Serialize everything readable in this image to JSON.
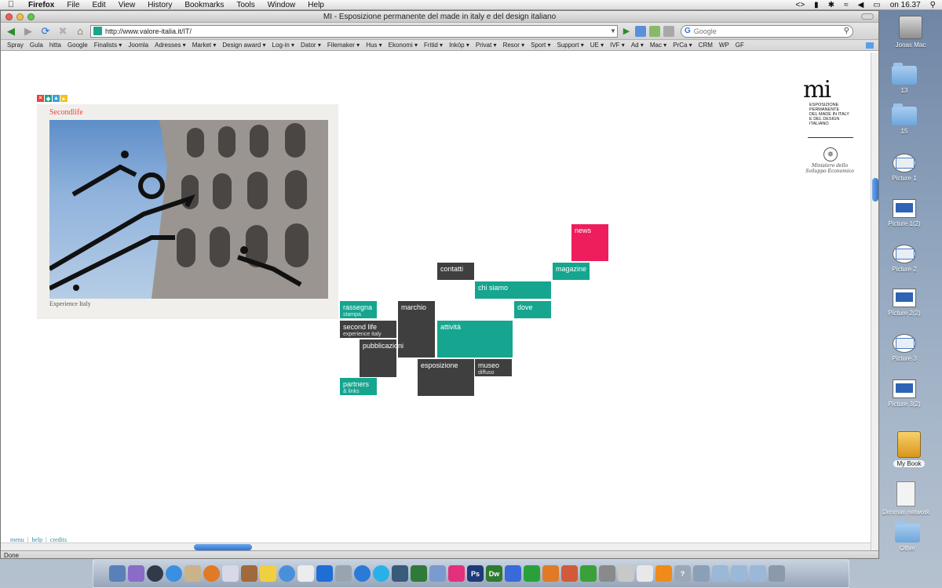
{
  "menubar": {
    "app": "Firefox",
    "items": [
      "File",
      "Edit",
      "View",
      "History",
      "Bookmarks",
      "Tools",
      "Window",
      "Help"
    ],
    "clock": "on 16.37"
  },
  "window": {
    "title": "MI - Esposizione permanente del made in italy e del design italiano"
  },
  "navbar": {
    "url": "http://www.valore-italia.it/IT/",
    "search_placeholder": "Google",
    "search_engine_icon": "G"
  },
  "bookmarks": [
    "Spray",
    "Gula",
    "hitta",
    "Google",
    "Finalists ▾",
    "Joomla",
    "Adresses ▾",
    "Market ▾",
    "Design award ▾",
    "Log-in ▾",
    "Dator ▾",
    "Filemaker ▾",
    "Hus ▾",
    "Ekonomi ▾",
    "Fritid ▾",
    "Inköp ▾",
    "Privat ▾",
    "Resor ▾",
    "Sport ▾",
    "Support ▾",
    "UE ▾",
    "IVF ▾",
    "Ad ▾",
    "Mac ▾",
    "PrCa ▾",
    "CRM",
    "WP",
    "GF"
  ],
  "status": "Done",
  "page": {
    "panel": {
      "title": "Secondlife",
      "caption": "Experience Italy"
    },
    "logo": {
      "mark": "mi",
      "lines": [
        "Esposizione",
        "permanente",
        "del made in italy",
        "e del design",
        "italiano"
      ],
      "ministry": "Ministero dello Sviluppo Economico"
    },
    "tiles": {
      "news": "news",
      "magazine": "magazine",
      "contatti": "contatti",
      "chi_siamo": "chi siamo",
      "dove": "dove",
      "rassegna": "rassegna",
      "rassegna_sub": "stampa",
      "marchio": "marchio",
      "second_life": "second life",
      "second_life_sub": "experience italy",
      "attivita": "attività",
      "pubblicazioni": "pubblicazioni",
      "esposizione": "esposizione",
      "museo": "museo",
      "museo_sub": "diffuso",
      "partners": "partners",
      "partners_sub": "& links"
    },
    "footer": {
      "menu": "menu",
      "help": "help",
      "credits": "credits",
      "sep": "|"
    }
  },
  "desktop": {
    "icons": [
      "Jonas Mac",
      "13",
      "15",
      "Picture 1",
      "Picture 1(2)",
      "Picture 2",
      "Picture 2(2)",
      "Picture 3",
      "Picture 3(2)",
      "My Book",
      "Dimman network",
      "Other"
    ]
  },
  "colors": {
    "teal": "#16a58f",
    "dark": "#3f3f3f",
    "pink": "#ee1d5c",
    "accent_red": "#e8423f"
  }
}
